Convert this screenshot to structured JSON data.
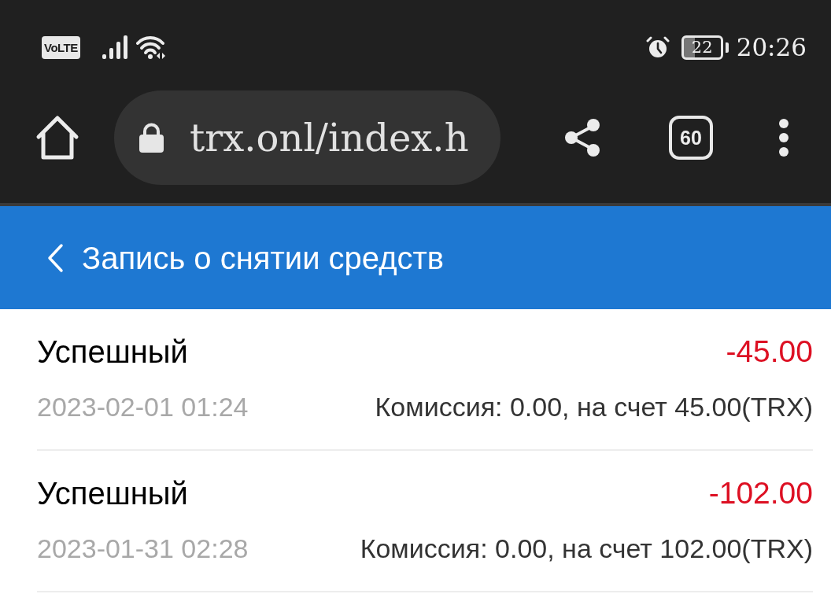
{
  "status_bar": {
    "network_badge": "VoLTE",
    "battery": "22",
    "time": "20:26"
  },
  "browser_toolbar": {
    "url": "trx.onl/index.h",
    "tab_count": "60"
  },
  "header": {
    "title": "Запись о снятии средств"
  },
  "withdrawals": [
    {
      "status": "Успешный",
      "amount": "-45.00",
      "date": "2023-02-01 01:24",
      "details": "Комиссия: 0.00, на счет 45.00(TRX)"
    },
    {
      "status": "Успешный",
      "amount": "-102.00",
      "date": "2023-01-31 02:28",
      "details": "Комиссия: 0.00, на счет 102.00(TRX)"
    }
  ]
}
